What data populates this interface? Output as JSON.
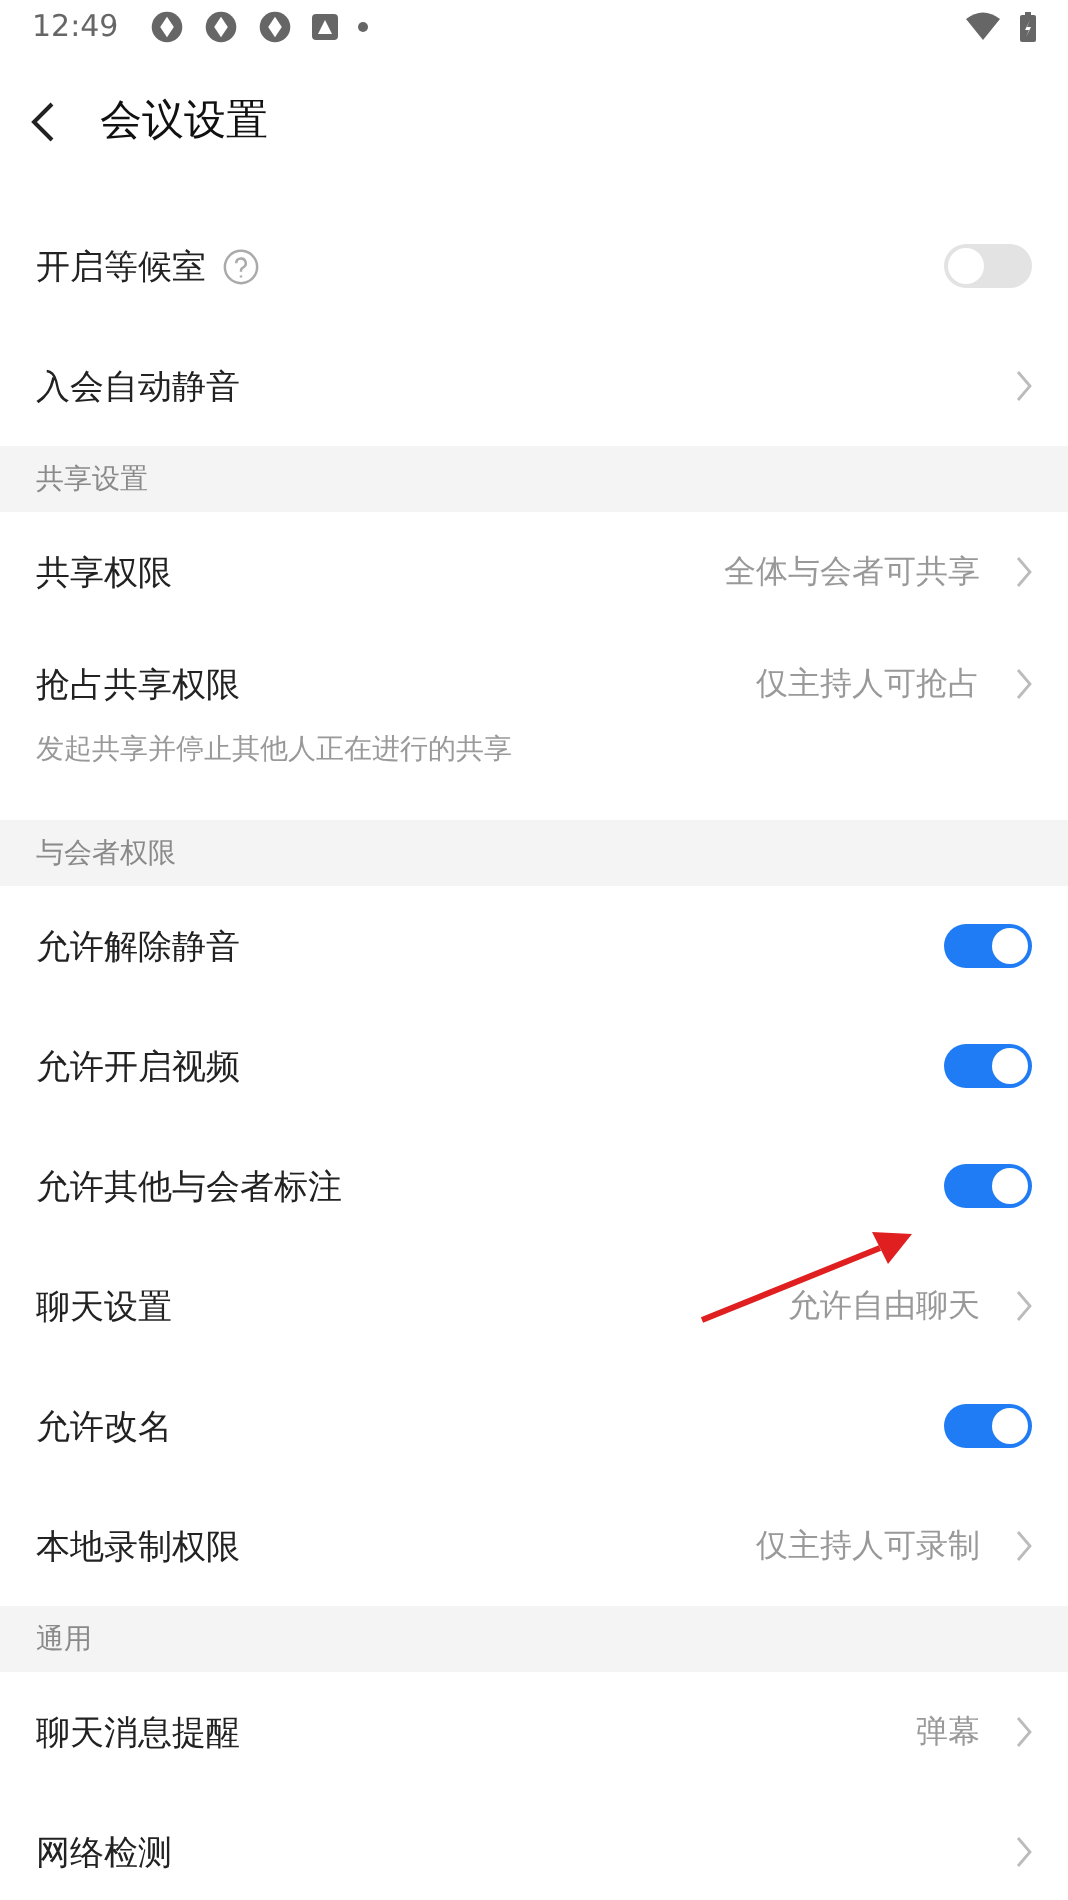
{
  "status_bar": {
    "time": "12:49"
  },
  "header": {
    "title": "会议设置"
  },
  "sections": [
    {
      "items": [
        {
          "kind": "toggle",
          "label": "开启等候室",
          "help": true,
          "on": false
        },
        {
          "kind": "link",
          "label": "入会自动静音"
        }
      ]
    },
    {
      "title": "共享设置",
      "items": [
        {
          "kind": "link",
          "label": "共享权限",
          "value": "全体与会者可共享"
        },
        {
          "kind": "link",
          "label": "抢占共享权限",
          "value": "仅主持人可抢占",
          "note": "发起共享并停止其他人正在进行的共享"
        }
      ]
    },
    {
      "title": "与会者权限",
      "items": [
        {
          "kind": "toggle",
          "label": "允许解除静音",
          "on": true
        },
        {
          "kind": "toggle",
          "label": "允许开启视频",
          "on": true
        },
        {
          "kind": "toggle",
          "label": "允许其他与会者标注",
          "on": true
        },
        {
          "kind": "link",
          "label": "聊天设置",
          "value": "允许自由聊天"
        },
        {
          "kind": "toggle",
          "label": "允许改名",
          "on": true
        },
        {
          "kind": "link",
          "label": "本地录制权限",
          "value": "仅主持人可录制"
        }
      ]
    },
    {
      "title": "通用",
      "items": [
        {
          "kind": "link",
          "label": "聊天消息提醒",
          "value": "弹幕"
        },
        {
          "kind": "link",
          "label": "网络检测"
        }
      ]
    }
  ]
}
